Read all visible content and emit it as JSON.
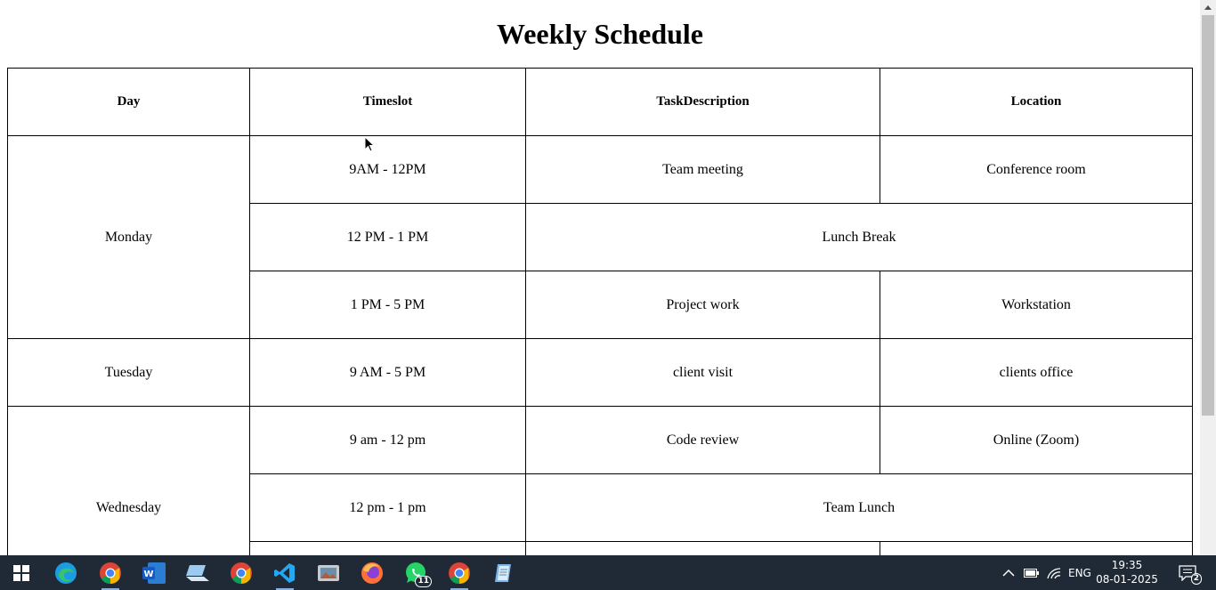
{
  "page": {
    "title": "Weekly Schedule"
  },
  "table": {
    "headers": [
      "Day",
      "Timeslot",
      "TaskDescription",
      "Location"
    ],
    "rows": {
      "monday": {
        "day": "Monday",
        "slots": [
          {
            "time": "9AM - 12PM",
            "task": "Team meeting",
            "location": "Conference room"
          },
          {
            "time": "12 PM - 1 PM",
            "merged": "Lunch Break"
          },
          {
            "time": "1 PM - 5 PM",
            "task": "Project work",
            "location": "Workstation"
          }
        ]
      },
      "tuesday": {
        "day": "Tuesday",
        "slots": [
          {
            "time": "9 AM - 5 PM",
            "task": "client visit",
            "location": "clients office"
          }
        ]
      },
      "wednesday": {
        "day": "Wednesday",
        "slots": [
          {
            "time": "9 am - 12 pm",
            "task": "Code review",
            "location": "Online (Zoom)"
          },
          {
            "time": "12 pm - 1 pm",
            "merged": "Team Lunch"
          },
          {
            "time": "",
            "task": "",
            "location": ""
          }
        ]
      }
    }
  },
  "taskbar": {
    "apps": [
      "windows-start-icon",
      "edge-icon",
      "chrome-icon",
      "word-icon",
      "file-explorer-icon",
      "chrome-icon",
      "vscode-icon",
      "photos-icon",
      "firefox-icon",
      "whatsapp-icon",
      "chrome-icon",
      "notepad-icon"
    ],
    "whatsapp_badge": "11",
    "language": "ENG",
    "time": "19:35",
    "date": "08-01-2025",
    "notification_count": "2"
  }
}
